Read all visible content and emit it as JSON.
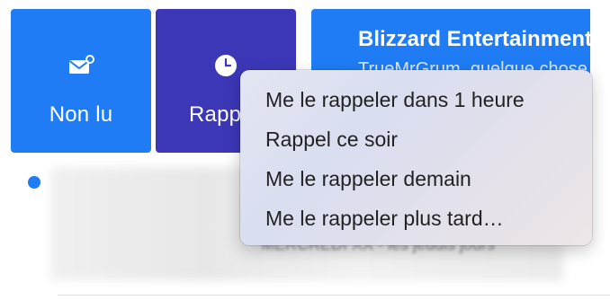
{
  "actions": {
    "unread_label": "Non lu",
    "remind_label": "Rappel"
  },
  "message": {
    "sender": "Blizzard Entertainment",
    "preview": "TrueMrGrum, quelque chose"
  },
  "list": {
    "blurred_text": "MERCREDI XX - les jeudis jours"
  },
  "reminder_menu": {
    "items": [
      "Me le rappeler dans 1 heure",
      "Rappel ce soir",
      "Me le rappeler demain",
      "Me le rappeler plus tard…"
    ]
  },
  "colors": {
    "unread_tile": "#1f7cf5",
    "remind_tile": "#3c37b6",
    "unread_dot": "#1f7cf5"
  },
  "icons": {
    "unread": "envelope-badge-icon",
    "remind": "clock-icon"
  }
}
